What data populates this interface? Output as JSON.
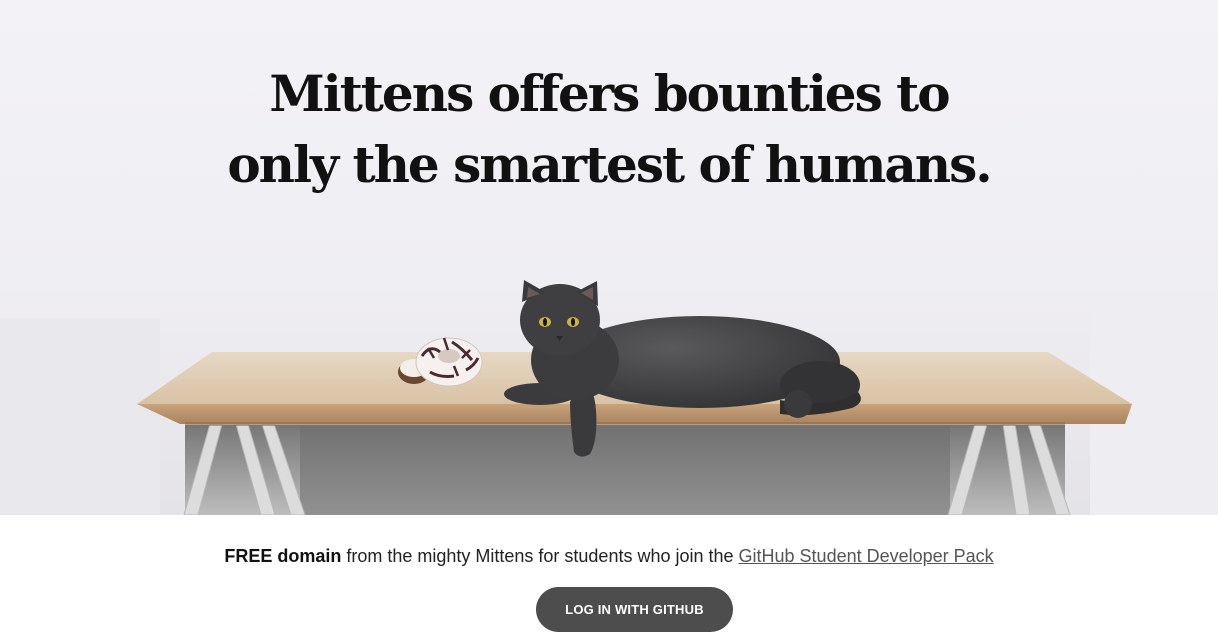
{
  "hero": {
    "headline_line1": "Mittens offers bounties to",
    "headline_line2": "only the smartest of humans.",
    "illustration": "cat-on-table-with-donut"
  },
  "promo": {
    "bold": "FREE domain",
    "middle": " from the mighty Mittens for students who join the ",
    "link": "GitHub Student Developer Pack"
  },
  "actions": {
    "login_label": "LOG IN WITH GITHUB"
  },
  "colors": {
    "hero_bg": "#f3f2f6",
    "button_bg": "#4d4d4d",
    "text": "#111111",
    "link": "#555555"
  }
}
